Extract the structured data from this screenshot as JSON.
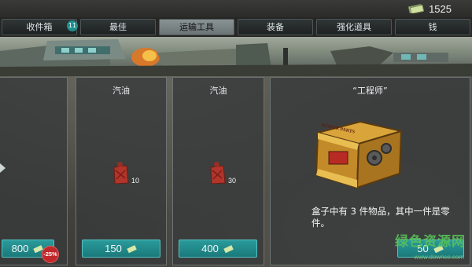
{
  "topbar": {
    "cash_icon": "cash-bills-icon",
    "cash_value": "1525"
  },
  "tabs": [
    {
      "label": "收件箱",
      "badge": "11",
      "active": false
    },
    {
      "label": "最佳",
      "active": false
    },
    {
      "label": "运输工具",
      "active": true
    },
    {
      "label": "装备",
      "active": false
    },
    {
      "label": "强化道具",
      "active": false
    },
    {
      "label": "钱",
      "active": false
    }
  ],
  "offers": [
    {
      "price": "800",
      "discount": "-25%"
    },
    {
      "title": "汽油",
      "quantity": "10",
      "price": "150",
      "icon": "gas-can-icon"
    },
    {
      "title": "汽油",
      "quantity": "30",
      "price": "400",
      "icon": "gas-can-icon"
    },
    {
      "title": "“工程师”",
      "description": "盒子中有 3 件物品，其中一件是零件。",
      "price": "50",
      "icon": "repair-parts-crate-icon",
      "crate_text": "REPAIR PARTS"
    }
  ],
  "watermark": {
    "title": "绿色资源网",
    "url": "www.downcc.com"
  },
  "colors": {
    "accent": "#1f8e8e",
    "discount": "#c0282b"
  }
}
